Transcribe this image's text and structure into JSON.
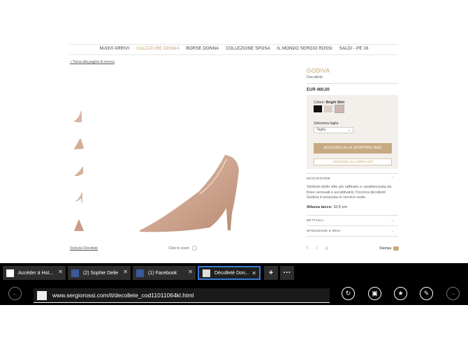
{
  "nav": {
    "items": [
      "NUOVI ARRIVI",
      "CALZATURE DONNA",
      "BORSE DONNA",
      "COLLEZIONE SPOSA",
      "IL MONDO SERGIO ROSSI",
      "SALDI - PE 16"
    ],
    "active_index": 1,
    "accent_color": "#c49a5c"
  },
  "back_link": "Torna alla pagina di ricerca",
  "gallery": {
    "see_more": "Vedi più Décolleté",
    "click_to_zoom": "Click to zoom"
  },
  "product": {
    "name": "GODIVA",
    "type": "Décolleté",
    "price": "EUR 460,00",
    "color_label": "Colore:",
    "color_value": "Bright Skin",
    "swatches": [
      "#111111",
      "#d9cfc8",
      "#cdb7b3"
    ],
    "size_label": "Seleziona taglia",
    "size_value": "Taglia",
    "add_to_bag": "AGGIUNGI ALLA SHOPPING BAG",
    "add_to_wishlist": "AGGIUNGI ALLA WISH LIST",
    "description_title": "DESCRIZIONE",
    "description": "Simbolo dello stile più raffinato e caratterizzata da linee sensuali e accattivanti, l'iconica décolleté Godiva è proposta in vernice nude.",
    "heel_label": "Altezza tacco:",
    "heel_value": "10,5  cm",
    "details_title": "DETTAGLI",
    "shipping_title": "SPEDIZIONE E RESI",
    "print_label": "Stampa"
  },
  "browser": {
    "tabs": [
      {
        "title": "Accéder à Hot...",
        "icon": "login-icon"
      },
      {
        "title": "(2) Sophie Delie",
        "icon": "facebook-icon"
      },
      {
        "title": "(1) Facebook",
        "icon": "facebook-icon"
      },
      {
        "title": "Décolleté Don...",
        "icon": "shoe-icon"
      }
    ],
    "active_tab": 3,
    "new_tab": "+",
    "more": "···",
    "url": "www.sergiorossi.com/it/decollete_cod11011064kl.html"
  }
}
